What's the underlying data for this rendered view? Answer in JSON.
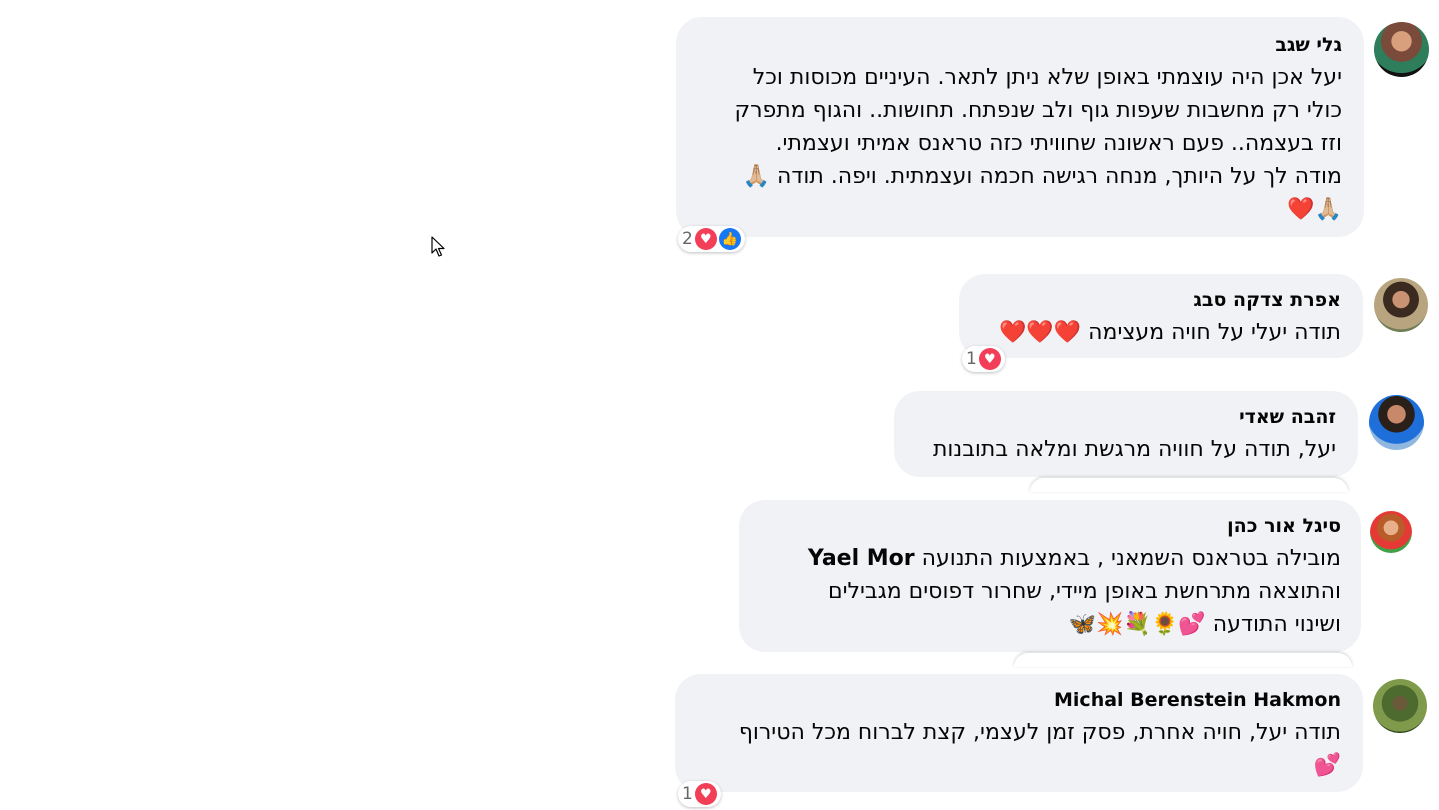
{
  "comments": [
    {
      "author": "גלי שגב",
      "text": "יעל אכן היה עוצמתי באופן שלא ניתן לתאר. העיניים מכוסות וכל\nכולי רק מחשבות שעפות גוף ולב שנפתח. תחושות.. והגוף מתפרק\nוזז בעצמה.. פעם ראשונה שחוויתי כזה טראנס אמיתי ועצמתי.\nמודה לך על היותך, מנחה רגישה חכמה ועצמתית. ויפה. תודה 🙏🏼\n🙏🏼❤️",
      "reaction_count": "2",
      "reactions": [
        "like",
        "love"
      ]
    },
    {
      "author": "אפרת צדקה סבג",
      "text": "תודה יעלי על חויה מעצימה ❤️❤️❤️",
      "reaction_count": "1",
      "reactions": [
        "love"
      ]
    },
    {
      "author": "זהבה שאדי",
      "text": "יעל, תודה על חוויה מרגשת ומלאה בתובנות"
    },
    {
      "author": "סיגל אור כהן",
      "text_before_tag": "מובילה בטראנס השמאני , באמצעות התנועה ",
      "tag": "Yael Mor",
      "text_after_tag": "\nוהתוצאה מתרחשת באופן מיידי, שחרור דפוסים מגבילים\nושינוי התודעה 💕🌻💐💥🦋"
    },
    {
      "author": "Michal Berenstein Hakmon",
      "text": "תודה יעל, חויה אחרת, פסק זמן לעצמי, קצת לברוח מכל הטירוף\n💕",
      "reaction_count": "1",
      "reactions": [
        "love"
      ]
    }
  ],
  "colors": {
    "bubble": "#f0f2f5",
    "love": "#f33e58",
    "like": "#1877f2",
    "text": "#050505",
    "muted": "#65676b"
  },
  "icons": [
    "heart-icon",
    "thumbs-up-icon",
    "mouse-cursor-icon"
  ]
}
